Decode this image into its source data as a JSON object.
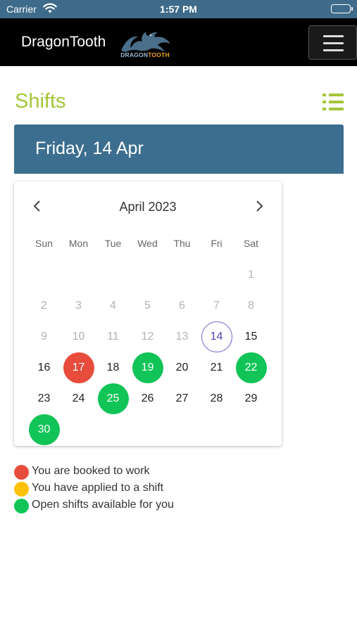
{
  "status_bar": {
    "carrier": "Carrier",
    "time": "1:57 PM"
  },
  "navbar": {
    "brand": "DragonTooth",
    "logo_text_part1": "DRAGON",
    "logo_text_part2": "TOOTH"
  },
  "page": {
    "title": "Shifts",
    "selected_date_label": "Friday, 14 Apr"
  },
  "calendar": {
    "month_label": "April 2023",
    "weekdays": [
      "Sun",
      "Mon",
      "Tue",
      "Wed",
      "Thu",
      "Fri",
      "Sat"
    ],
    "days": [
      {
        "d": "1",
        "muted": true
      },
      {
        "d": "2",
        "muted": true
      },
      {
        "d": "3",
        "muted": true
      },
      {
        "d": "4",
        "muted": true
      },
      {
        "d": "5",
        "muted": true
      },
      {
        "d": "6",
        "muted": true
      },
      {
        "d": "7",
        "muted": true
      },
      {
        "d": "8",
        "muted": true
      },
      {
        "d": "9",
        "muted": true
      },
      {
        "d": "10",
        "muted": true
      },
      {
        "d": "11",
        "muted": true
      },
      {
        "d": "12",
        "muted": true
      },
      {
        "d": "13",
        "muted": true
      },
      {
        "d": "14",
        "status": "today"
      },
      {
        "d": "15"
      },
      {
        "d": "16"
      },
      {
        "d": "17",
        "status": "booked"
      },
      {
        "d": "18"
      },
      {
        "d": "19",
        "status": "open"
      },
      {
        "d": "20"
      },
      {
        "d": "21"
      },
      {
        "d": "22",
        "status": "open"
      },
      {
        "d": "23"
      },
      {
        "d": "24"
      },
      {
        "d": "25",
        "status": "open"
      },
      {
        "d": "26"
      },
      {
        "d": "27"
      },
      {
        "d": "28"
      },
      {
        "d": "29"
      },
      {
        "d": "30",
        "status": "open"
      }
    ]
  },
  "legend": [
    {
      "text": "You are booked to work",
      "color": "#e74c3c"
    },
    {
      "text": "You have applied to a shift",
      "color": "#ffc107"
    },
    {
      "text": "Open shifts available for you",
      "color": "#10c457"
    }
  ],
  "colors": {
    "accent": "#a4c639",
    "banner": "#3c6e8f",
    "status_bar": "#3e6b8a",
    "today_ring": "#6a63c9"
  },
  "icons": {
    "wifi": "wifi-icon",
    "battery": "battery-icon",
    "menu": "hamburger-menu-icon",
    "list": "list-view-icon",
    "prev": "chevron-left-icon",
    "next": "chevron-right-icon",
    "logo": "dragon-logo-icon"
  }
}
